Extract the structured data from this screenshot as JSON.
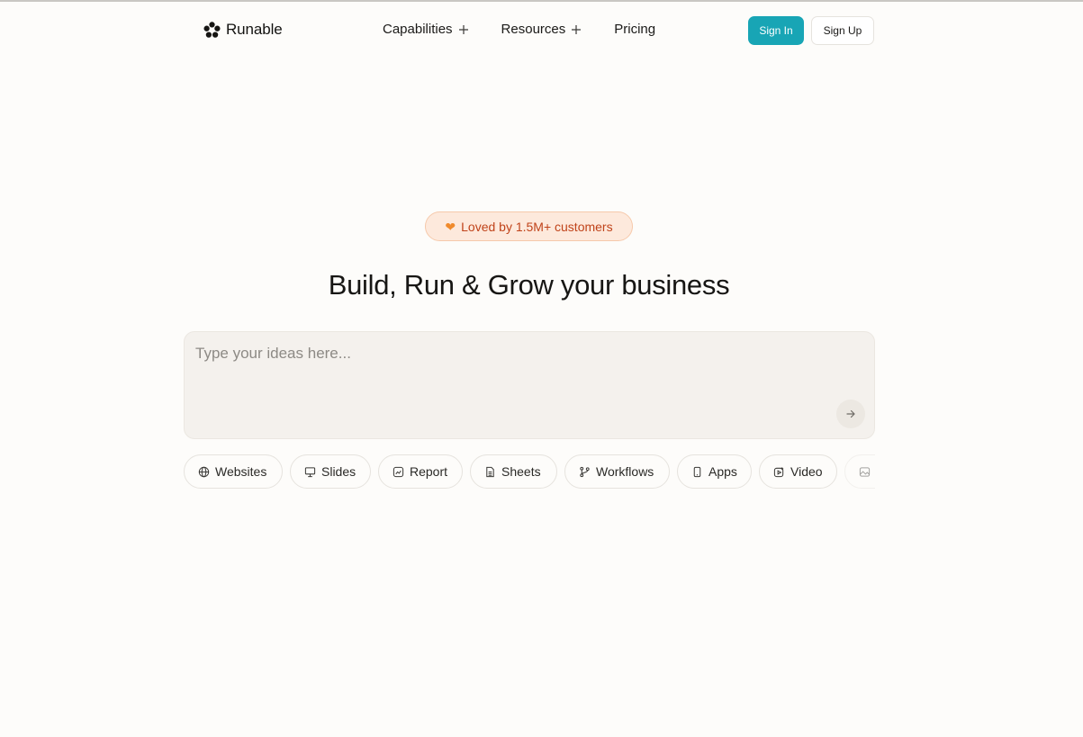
{
  "header": {
    "brand": "Runable",
    "nav": [
      {
        "label": "Capabilities",
        "expandable": true
      },
      {
        "label": "Resources",
        "expandable": true
      },
      {
        "label": "Pricing",
        "expandable": false
      }
    ],
    "sign_in": "Sign In",
    "sign_up": "Sign Up"
  },
  "hero": {
    "badge": {
      "icon": "orange-heart",
      "text": "Loved by 1.5M+ customers"
    },
    "headline": "Build, Run & Grow your business",
    "prompt": {
      "placeholder": "Type your ideas here...",
      "value": "",
      "send_icon": "arrow-right-icon"
    }
  },
  "chips": [
    {
      "label": "Websites",
      "icon": "globe-icon"
    },
    {
      "label": "Slides",
      "icon": "presentation-icon"
    },
    {
      "label": "Report",
      "icon": "report-icon"
    },
    {
      "label": "Sheets",
      "icon": "sheet-icon"
    },
    {
      "label": "Workflows",
      "icon": "git-branch-icon"
    },
    {
      "label": "Apps",
      "icon": "phone-icon"
    },
    {
      "label": "Video",
      "icon": "video-icon"
    },
    {
      "label": "",
      "icon": "image-icon"
    }
  ],
  "colors": {
    "background": "#fdfcfa",
    "accent": "#18a5b5",
    "badge_bg": "#fde9dc",
    "badge_text": "#c0431a",
    "prompt_bg": "#f4f1ed"
  }
}
